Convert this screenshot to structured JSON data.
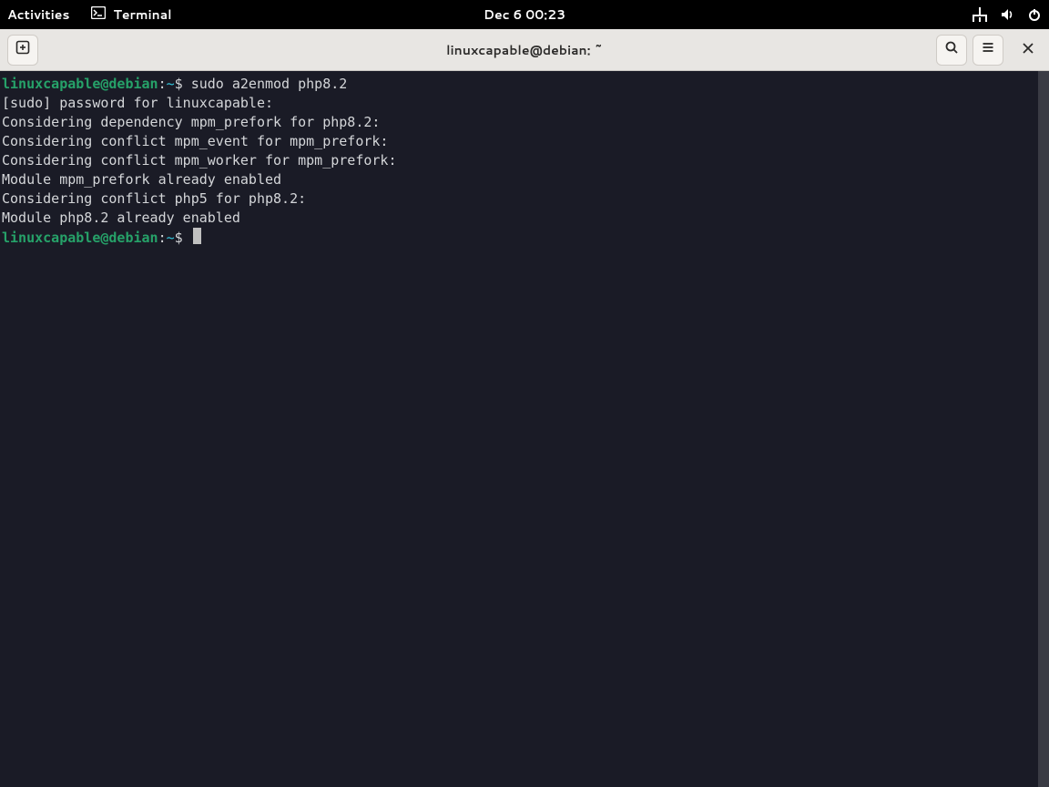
{
  "topbar": {
    "activities": "Activities",
    "app_name": "Terminal",
    "clock": "Dec 6  00:23"
  },
  "headerbar": {
    "title": "linuxcapable@debian: ~"
  },
  "prompt": {
    "user_host": "linuxcapable@debian",
    "sep1": ":",
    "path": "~",
    "sigil": "$ "
  },
  "session": {
    "command": "sudo a2enmod php8.2",
    "lines": [
      "[sudo] password for linuxcapable:",
      "Considering dependency mpm_prefork for php8.2:",
      "Considering conflict mpm_event for mpm_prefork:",
      "Considering conflict mpm_worker for mpm_prefork:",
      "Module mpm_prefork already enabled",
      "Considering conflict php5 for php8.2:",
      "Module php8.2 already enabled"
    ]
  }
}
